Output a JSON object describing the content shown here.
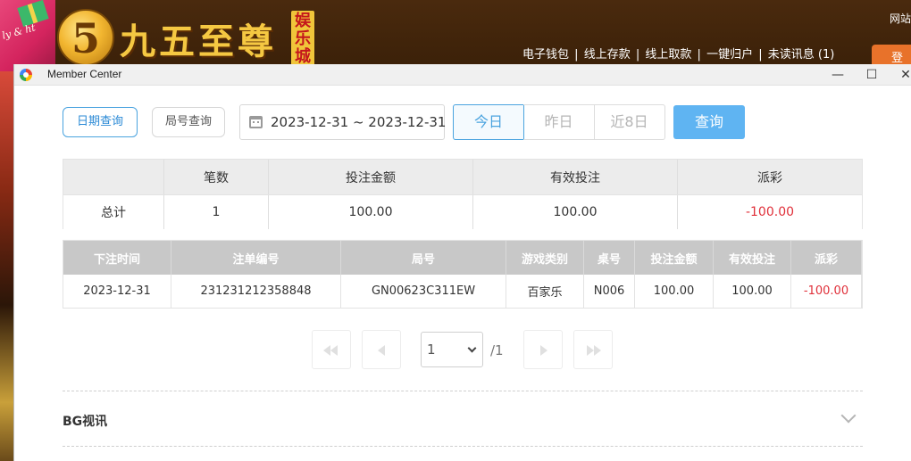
{
  "site": {
    "logo_text": "九五至尊",
    "logo_badge": "娱乐城",
    "logo_numeral": "5",
    "deco_script": "ly & ht",
    "nav": [
      "电子钱包",
      "|",
      "线上存款",
      "|",
      "线上取款",
      "|",
      "一键归户",
      "|",
      "未读讯息 (1)"
    ],
    "top_right": "网站",
    "login_label": "登"
  },
  "window": {
    "title": "Member Center",
    "min": "—",
    "max": "☐",
    "close": "✕"
  },
  "filters": {
    "tab_date": "日期查询",
    "tab_round": "局号查询",
    "date_range": "2023-12-31 ~ 2023-12-31",
    "today": "今日",
    "yesterday": "昨日",
    "last8": "近8日",
    "query": "查询"
  },
  "summary": {
    "headers": [
      "",
      "笔数",
      "投注金额",
      "有效投注",
      "派彩"
    ],
    "row": [
      "总计",
      "1",
      "100.00",
      "100.00",
      "-100.00"
    ]
  },
  "detail": {
    "headers": [
      "下注时间",
      "注单编号",
      "局号",
      "游戏类别",
      "桌号",
      "投注金额",
      "有效投注",
      "派彩"
    ],
    "rows": [
      [
        "2023-12-31",
        "231231212358848",
        "GN00623C311EW",
        "百家乐",
        "N006",
        "100.00",
        "100.00",
        "-100.00"
      ]
    ]
  },
  "pagination": {
    "current": "1",
    "total": "/1"
  },
  "section": {
    "title": "BG视讯"
  },
  "colors": {
    "accent_blue": "#4aa3df",
    "query_blue": "#5fb4f2",
    "negative_red": "#e0303a"
  }
}
